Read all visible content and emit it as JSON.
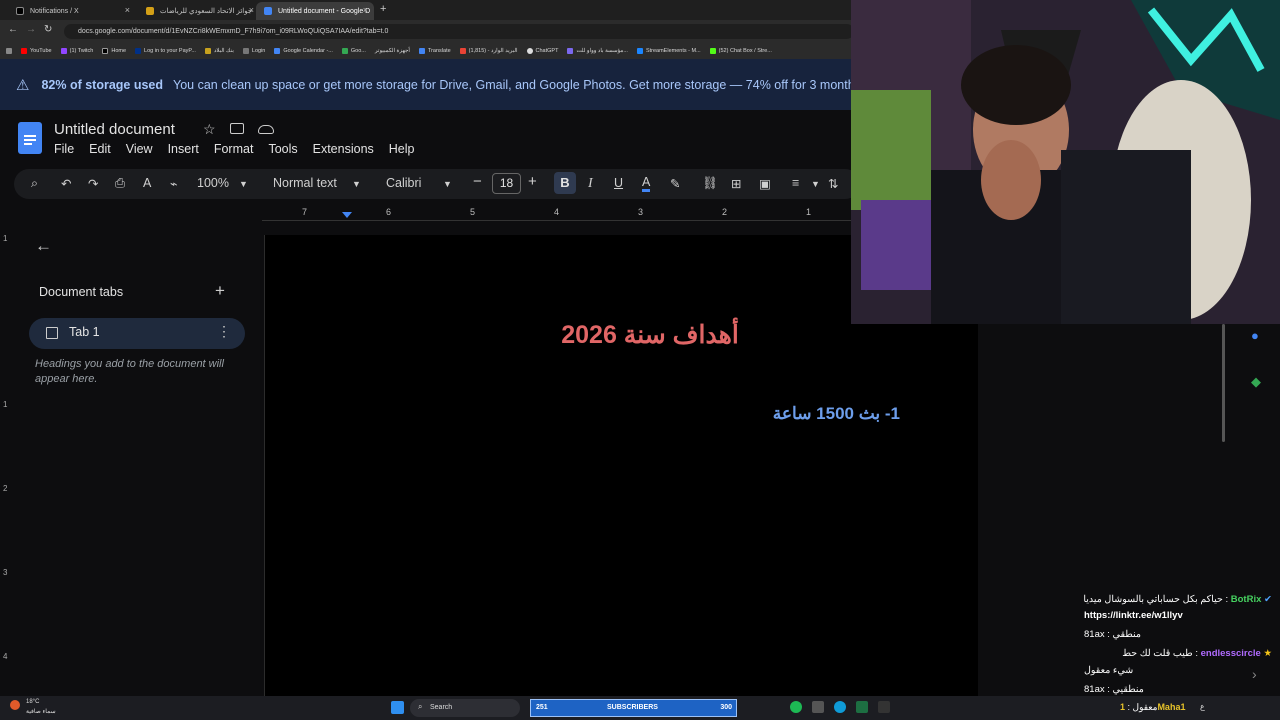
{
  "browser": {
    "tabs": [
      {
        "label": "Notifications / X",
        "active": false
      },
      {
        "label": "جوائز الاتحاد السعودي للرياضات",
        "active": false
      },
      {
        "label": "Untitled document - Google D",
        "active": true
      }
    ],
    "url": "docs.google.com/document/d/1EvNZCri8kWEmxmD_F7h9i7om_i09RLWoQUiQSA7IAA/edit?tab=t.0",
    "bookmarks": [
      "YouTube",
      "(1) Twitch",
      "Home",
      "Log in to your PayP...",
      "بنك البلاد",
      "Login",
      "Google Calendar -...",
      "Goo...",
      "أجهزة الكمبيوتر",
      "Translate",
      "البريد الوارد - (1,815)",
      "ChatGPT",
      "مؤسسة باد وواو للت...",
      "StreamElements - M...",
      "(52) Chat Box / Stre..."
    ]
  },
  "banner": {
    "bold": "82% of storage used",
    "message": "You can clean up space or get more storage for Drive, Gmail, and Google Photos. Get more storage — 74% off for 3 months"
  },
  "doc": {
    "title": "Untitled document",
    "menu": [
      "File",
      "Edit",
      "View",
      "Insert",
      "Format",
      "Tools",
      "Extensions",
      "Help"
    ],
    "zoom": "100%",
    "style": "Normal text",
    "font": "Calibri",
    "font_size": "18",
    "ruler": [
      "7",
      "6",
      "5",
      "4",
      "3",
      "2",
      "1"
    ],
    "left_ruler": [
      "1",
      "1",
      "2",
      "3",
      "4"
    ],
    "heading": "أهداف سنة 2026",
    "line1": "1- بث 1500 ساعة"
  },
  "sidebar": {
    "title": "Document tabs",
    "tab": "Tab 1",
    "hint": "Headings you add to the document will appear here."
  },
  "chat": [
    {
      "user": "BotRix",
      "user_color": "#46d160",
      "text": "حياكم بكل حساباتي بالسوشال ميديا :"
    },
    {
      "user": "",
      "text": "https://linktr.ee/w1llyv"
    },
    {
      "user": "",
      "text": "81ax : منطقي"
    },
    {
      "user": "endlesscircle",
      "user_color": "#b06bff",
      "text": "طيب قلت لك حط :"
    },
    {
      "user": "",
      "text": "شيء معقول"
    },
    {
      "user": "",
      "text": "81ax : منطقيي"
    },
    {
      "user": "1Maha1",
      "user_color": "#e6c229",
      "text": "معقول :"
    }
  ],
  "taskbar": {
    "weather_temp": "18°C",
    "weather_desc": "سماء صافية",
    "search": "Search",
    "subs_count": "251",
    "subs_label": "SUBSCRIBERS",
    "subs_goal": "300",
    "lang": "ع"
  },
  "colors": {
    "accent": "#a8c7fa",
    "heading": "#e06666",
    "body_text": "#6d9eeb"
  }
}
